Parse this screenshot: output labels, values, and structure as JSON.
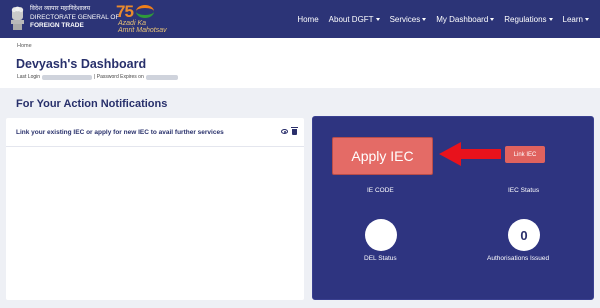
{
  "header": {
    "org_hindi": "विदेश व्यापार महानिदेशालय",
    "org_line1": "DIRECTORATE GENERAL OF",
    "org_line2": "FOREIGN TRADE",
    "azadi_number": "75",
    "azadi_line1": "Azadi Ka",
    "azadi_line2": "Amrit Mahotsav"
  },
  "nav": [
    {
      "label": "Home",
      "dropdown": false
    },
    {
      "label": "About DGFT",
      "dropdown": true
    },
    {
      "label": "Services",
      "dropdown": true
    },
    {
      "label": "My Dashboard",
      "dropdown": true
    },
    {
      "label": "Regulations",
      "dropdown": true
    },
    {
      "label": "Learn",
      "dropdown": true
    }
  ],
  "breadcrumb": "Home",
  "dashboard": {
    "title": "Devyash's Dashboard",
    "last_login_label": "Last Login",
    "password_expires_label": "| Password Expires on"
  },
  "notifications": {
    "title": "For Your Action Notifications",
    "items": [
      {
        "text": "Link your existing IEC or apply for new IEC to avail further services"
      }
    ]
  },
  "iec_panel": {
    "apply_label": "Apply IEC",
    "link_label": "Link IEC",
    "ie_code_label": "IE CODE",
    "iec_status_label": "IEC Status",
    "del_status_label": "DEL Status",
    "del_status_value": "",
    "authorisations_label": "Authorisations Issued",
    "authorisations_value": "0"
  },
  "colors": {
    "nav_bg": "#2c3477",
    "panel_bg": "#2e3480",
    "apply_button": "#e46b66",
    "arrow": "#e8121c"
  }
}
